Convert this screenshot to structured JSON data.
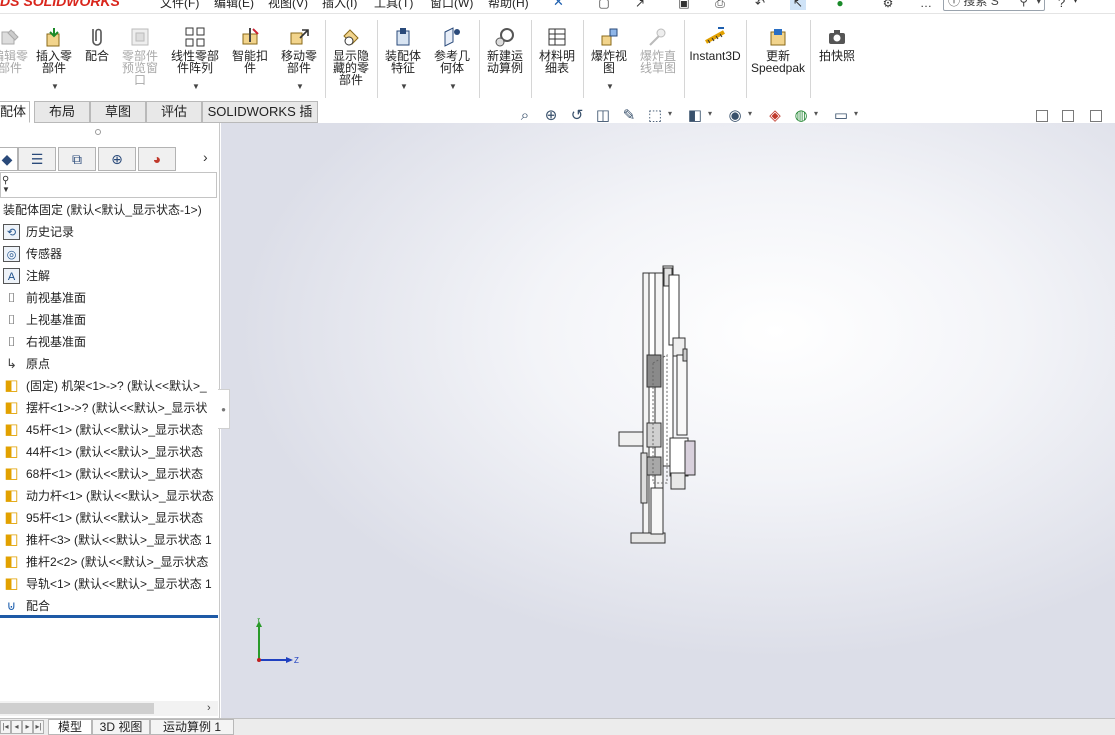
{
  "app": {
    "logo_text": "SOLIDWORKS",
    "menu": [
      "文件(F)",
      "编辑(E)",
      "视图(V)",
      "插入(I)",
      "工具(T)",
      "窗口(W)",
      "帮助(H)"
    ],
    "search_placeholder": "搜索 S",
    "help_label": "?"
  },
  "ribbon": {
    "items": [
      {
        "label": "编辑零\n部件",
        "icon": "edit-component-icon",
        "enabled": false
      },
      {
        "label": "插入零\n部件",
        "icon": "insert-component-icon",
        "enabled": true,
        "dropdown": true
      },
      {
        "label": "配合",
        "icon": "mate-icon",
        "enabled": true
      },
      {
        "label": "零部件\n预览窗\n口",
        "icon": "component-preview-icon",
        "enabled": false
      },
      {
        "label": "线性零部\n件阵列",
        "icon": "linear-pattern-icon",
        "enabled": true,
        "dropdown": true
      },
      {
        "label": "智能扣\n件",
        "icon": "smart-fasteners-icon",
        "enabled": true
      },
      {
        "label": "移动零\n部件",
        "icon": "move-component-icon",
        "enabled": true,
        "dropdown": true
      },
      {
        "label": "显示隐\n藏的零\n部件",
        "icon": "show-hidden-icon",
        "enabled": true
      },
      {
        "label": "装配体\n特征",
        "icon": "assembly-feature-icon",
        "enabled": true,
        "dropdown": true
      },
      {
        "label": "参考几\n何体",
        "icon": "reference-geometry-icon",
        "enabled": true,
        "dropdown": true
      },
      {
        "label": "新建运\n动算例",
        "icon": "new-motion-study-icon",
        "enabled": true
      },
      {
        "label": "材料明\n细表",
        "icon": "bill-of-materials-icon",
        "enabled": true
      },
      {
        "label": "爆炸视\n图",
        "icon": "exploded-view-icon",
        "enabled": true,
        "dropdown": true
      },
      {
        "label": "爆炸直\n线草图",
        "icon": "explode-line-sketch-icon",
        "enabled": false
      },
      {
        "label": "Instant3D",
        "icon": "instant3d-icon",
        "enabled": true
      },
      {
        "label": "更新\nSpeedpak",
        "icon": "speedpak-icon",
        "enabled": true
      },
      {
        "label": "拍快照",
        "icon": "snapshot-icon",
        "enabled": true
      }
    ]
  },
  "tabs": [
    "配体",
    "布局",
    "草图",
    "评估",
    "SOLIDWORKS 插件"
  ],
  "active_tab": 0,
  "feature_tree": {
    "root": "装配体固定 (默认<默认_显示状态-1>)",
    "items": [
      {
        "icon": "history-icon",
        "label": "历史记录"
      },
      {
        "icon": "sensor-icon",
        "label": "传感器"
      },
      {
        "icon": "annotation-icon",
        "label": "注解"
      },
      {
        "icon": "plane-icon",
        "label": "前视基准面"
      },
      {
        "icon": "plane-icon",
        "label": "上视基准面"
      },
      {
        "icon": "plane-icon",
        "label": "右视基准面"
      },
      {
        "icon": "origin-icon",
        "label": "原点"
      },
      {
        "icon": "part-icon",
        "label": "(固定) 机架<1>->? (默认<<默认>_"
      },
      {
        "icon": "part-icon",
        "label": "摆杆<1>->? (默认<<默认>_显示状"
      },
      {
        "icon": "part-icon",
        "label": "45杆<1> (默认<<默认>_显示状态"
      },
      {
        "icon": "part-icon",
        "label": "44杆<1> (默认<<默认>_显示状态"
      },
      {
        "icon": "part-icon",
        "label": "68杆<1> (默认<<默认>_显示状态"
      },
      {
        "icon": "part-icon",
        "label": "动力杆<1> (默认<<默认>_显示状态"
      },
      {
        "icon": "part-icon",
        "label": "95杆<1> (默认<<默认>_显示状态"
      },
      {
        "icon": "part-icon",
        "label": "推杆<3> (默认<<默认>_显示状态 1"
      },
      {
        "icon": "part-icon",
        "label": "推杆2<2> (默认<<默认>_显示状态"
      },
      {
        "icon": "part-icon",
        "label": "导轨<1> (默认<<默认>_显示状态 1"
      },
      {
        "icon": "mates-icon",
        "label": "配合"
      }
    ]
  },
  "bottom_tabs": [
    "模型",
    "3D 视图",
    "运动算例 1"
  ],
  "active_bottom_tab": 0,
  "triad": {
    "y_label": "Y",
    "z_label": "Z"
  },
  "colors": {
    "accent": "#1e5aa6",
    "part_icon": "#e2a100",
    "logo": "#d9251c"
  }
}
